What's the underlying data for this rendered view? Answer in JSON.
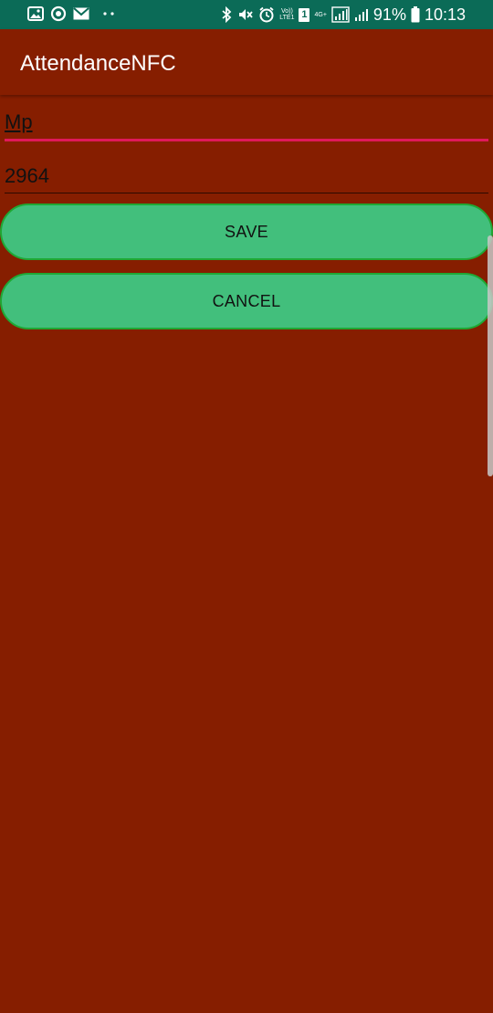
{
  "status_bar": {
    "battery_percent": "91%",
    "time": "10:13",
    "volte_label": "Vo))",
    "lte_label": "LTE1",
    "network_label": "4G+",
    "sim_label": "1",
    "left_icons": [
      "image-icon",
      "sync-icon",
      "mail-icon",
      "more-dots-icon"
    ],
    "right_icons": [
      "bluetooth-icon",
      "mute-icon",
      "alarm-icon",
      "volte-icon",
      "sim-icon",
      "signal-icon",
      "signal-icon-2",
      "battery-icon"
    ]
  },
  "app_bar": {
    "title": "AttendanceNFC"
  },
  "form": {
    "name_value": "Mp",
    "number_value": "2964"
  },
  "buttons": {
    "save_label": "SAVE",
    "cancel_label": "CANCEL"
  },
  "colors": {
    "status_bar_bg": "#0b6b57",
    "background": "#861e00",
    "accent_underline": "#e0195a",
    "button_fill": "#42bf7c",
    "button_border": "#1fa834"
  }
}
